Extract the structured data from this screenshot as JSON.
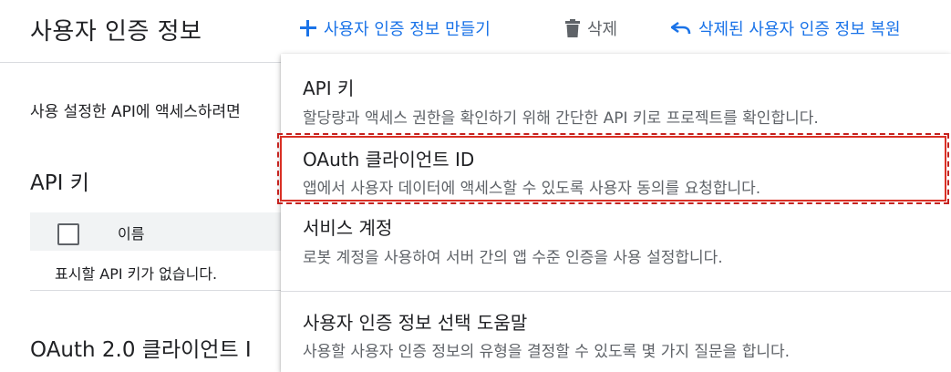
{
  "header": {
    "title": "사용자 인증 정보",
    "create_label": "사용자 인증 정보 만들기",
    "delete_label": "삭제",
    "restore_label": "삭제된 사용자 인증 정보 복원"
  },
  "main": {
    "description": "사용 설정한 API에 액세스하려면",
    "api_keys_heading": "API 키",
    "table": {
      "columns": [
        "이름"
      ],
      "empty_text": "표시할 API 키가 없습니다."
    },
    "oauth_heading": "OAuth 2.0 클라이언트 I"
  },
  "menu": {
    "items": [
      {
        "label": "API 키",
        "description": "할당량과 액세스 권한을 확인하기 위해 간단한 API 키로 프로젝트를 확인합니다."
      },
      {
        "label": "OAuth 클라이언트 ID",
        "description": "앱에서 사용자 데이터에 액세스할 수 있도록 사용자 동의를 요청합니다."
      },
      {
        "label": "서비스 계정",
        "description": "로봇 계정을 사용하여 서버 간의 앱 수준 인증을 사용 설정합니다."
      },
      {
        "label": "사용자 인증 정보 선택 도움말",
        "description": "사용할 사용자 인증 정보의 유형을 결정할 수 있도록 몇 가지 질문을 합니다."
      }
    ]
  },
  "colors": {
    "accent": "#1a73e8",
    "highlight": "#d93025"
  },
  "icons": {
    "create": "plus-icon",
    "delete": "trash-icon",
    "restore": "undo-icon"
  }
}
